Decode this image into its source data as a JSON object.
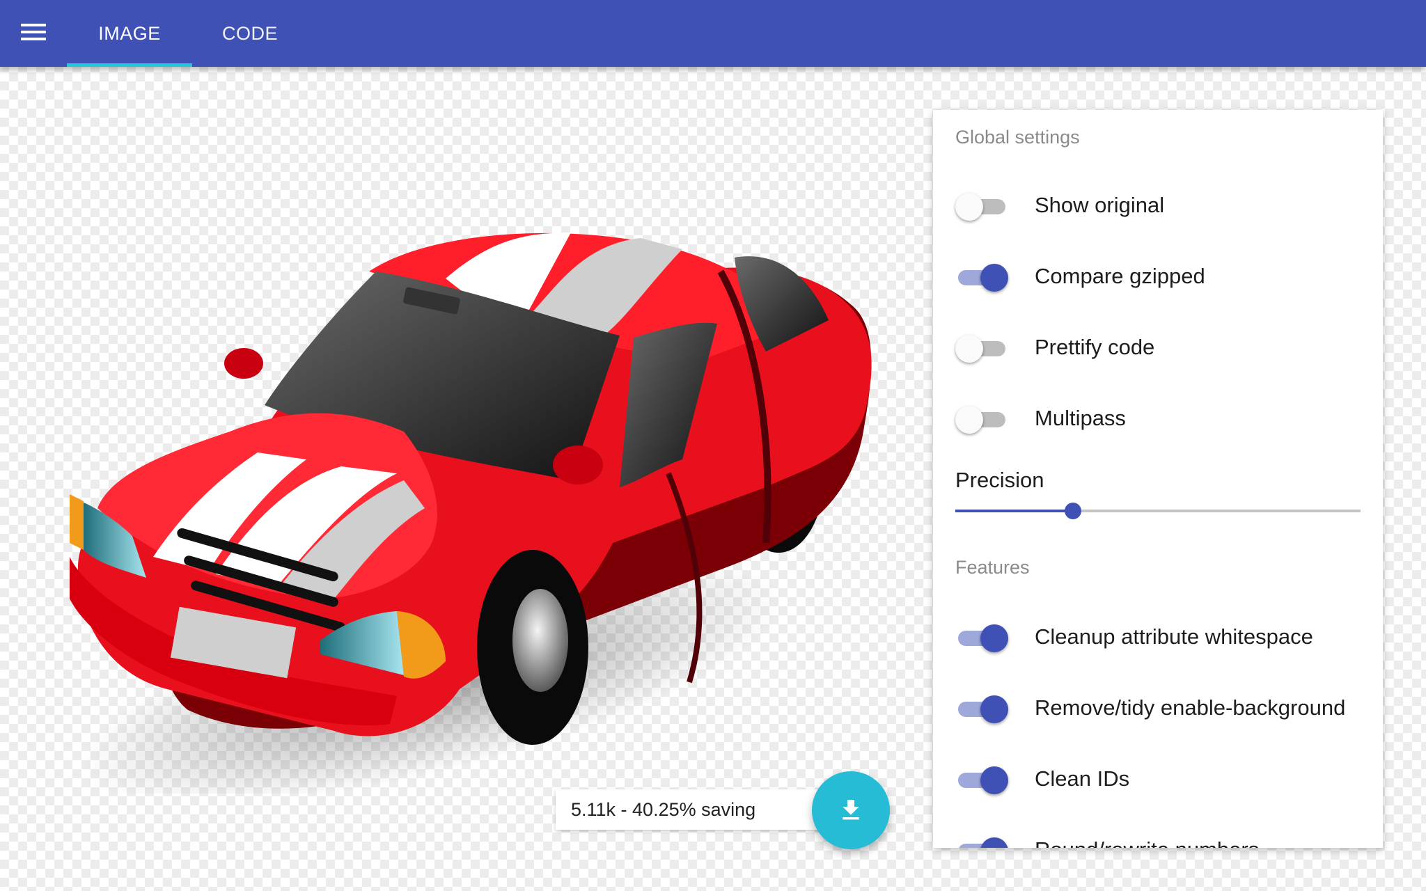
{
  "header": {
    "tabs": [
      {
        "label": "IMAGE",
        "active": true
      },
      {
        "label": "CODE",
        "active": false
      }
    ],
    "menu_icon": "hamburger-menu-icon",
    "colors": {
      "bar": "#3f51b5",
      "indicator": "#26c6da"
    }
  },
  "result": {
    "summary": "5.11k - 40.25% saving",
    "download_icon": "download-icon"
  },
  "settings": {
    "global_title": "Global settings",
    "global": [
      {
        "label": "Show original",
        "on": false
      },
      {
        "label": "Compare gzipped",
        "on": true
      },
      {
        "label": "Prettify code",
        "on": false
      },
      {
        "label": "Multipass",
        "on": false
      }
    ],
    "precision": {
      "label": "Precision",
      "fraction": 0.29
    },
    "features_title": "Features",
    "features": [
      {
        "label": "Cleanup attribute whitespace",
        "on": true
      },
      {
        "label": "Remove/tidy enable-background",
        "on": true
      },
      {
        "label": "Clean IDs",
        "on": true
      },
      {
        "label": "Round/rewrite numbers",
        "on": true
      }
    ]
  },
  "preview": {
    "image_subject": "red sports car with white racing stripes"
  }
}
